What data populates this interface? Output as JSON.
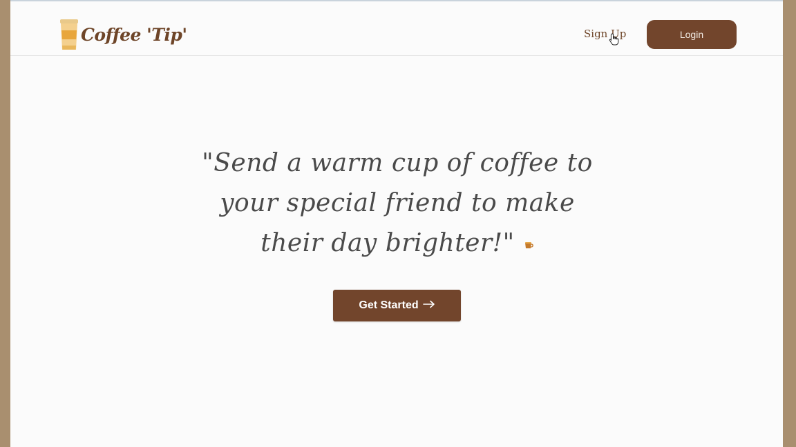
{
  "brand": {
    "name": "Coffee 'Tip'",
    "logo_icon": "coffee-cup-icon"
  },
  "nav": {
    "signup_label": "Sign Up",
    "login_label": "Login"
  },
  "hero": {
    "quote": "\"Send a warm cup of coffee to your special friend to make their day brighter!\"",
    "emoji_icon": "coffee-emoji-icon"
  },
  "cta": {
    "label": "Get Started",
    "arrow_icon": "arrow-right-icon"
  },
  "colors": {
    "brand_brown": "#72452c",
    "text_dark": "#4a4a4a",
    "page_bg": "#fbfbfb",
    "frame_bg": "#a98f6f"
  }
}
